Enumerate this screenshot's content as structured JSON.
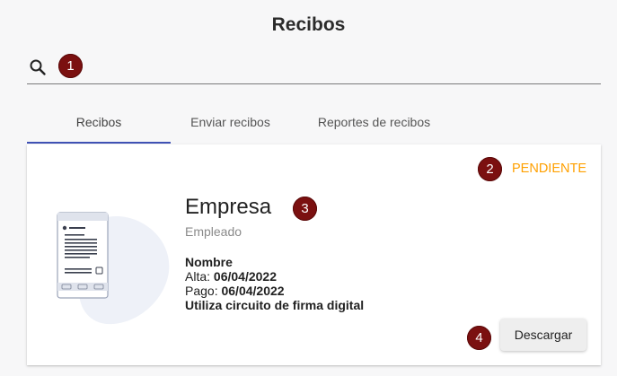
{
  "page": {
    "title": "Recibos"
  },
  "search": {
    "placeholder": ""
  },
  "markers": [
    "1",
    "2",
    "3",
    "4"
  ],
  "tabs": [
    {
      "label": "Recibos",
      "active": true
    },
    {
      "label": "Enviar recibos",
      "active": false
    },
    {
      "label": "Reportes de recibos",
      "active": false
    }
  ],
  "receipt": {
    "status": "PENDIENTE",
    "company": "Empresa",
    "employee": "Empleado",
    "name_label": "Nombre",
    "alta_label": "Alta:",
    "alta_value": "06/04/2022",
    "pago_label": "Pago:",
    "pago_value": "06/04/2022",
    "digital_signature": "Utiliza circuito de firma digital",
    "download_label": "Descargar"
  },
  "colors": {
    "accent": "#3f51b5",
    "status": "#ffa000",
    "marker": "#7b1010"
  }
}
